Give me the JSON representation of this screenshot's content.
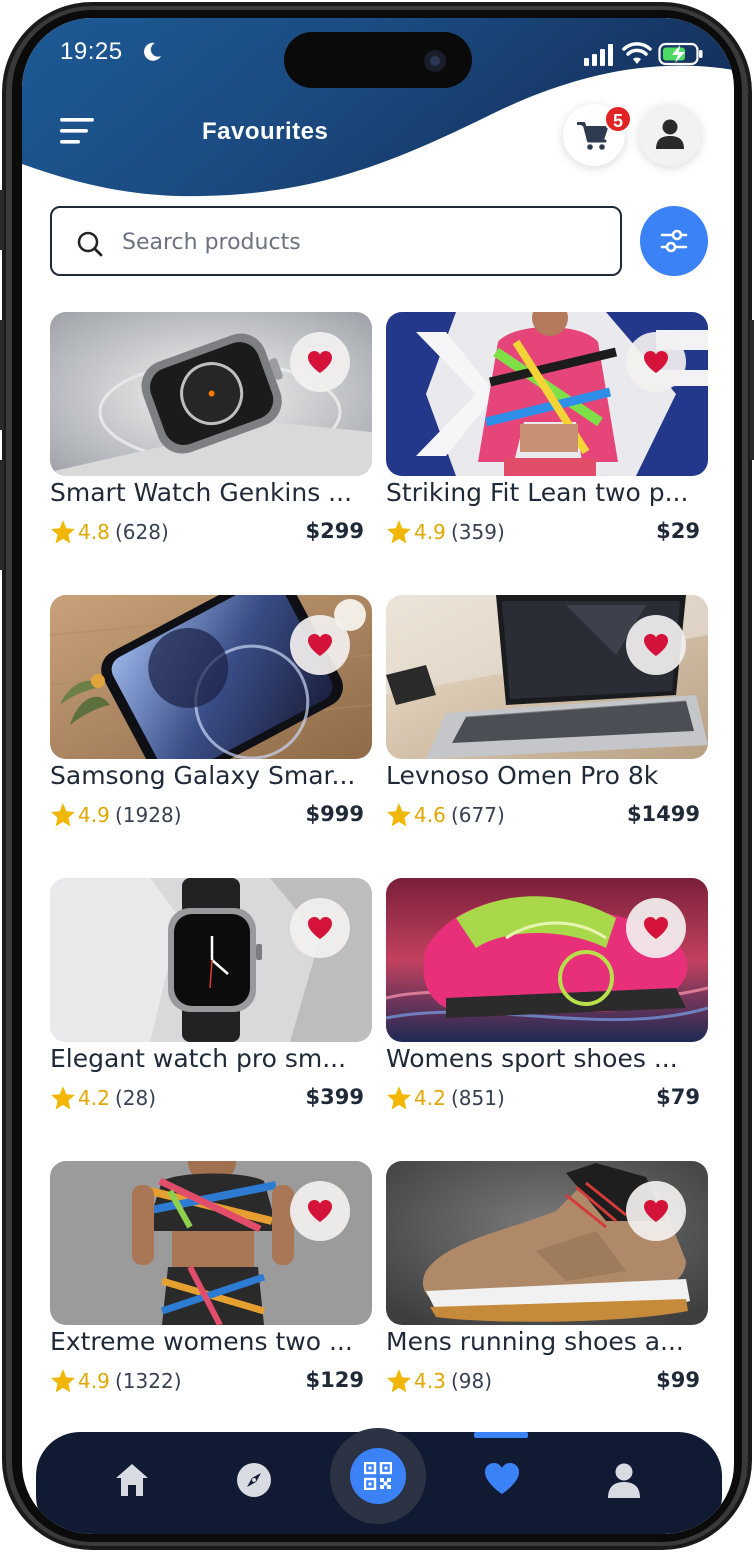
{
  "status": {
    "time": "19:25"
  },
  "header": {
    "title": "Favourites",
    "cart_badge": "5"
  },
  "search": {
    "placeholder": "Search products",
    "value": ""
  },
  "products": [
    {
      "name": "Smart Watch Genkins ...",
      "rating": "4.8",
      "count": "(628)",
      "price": "$299",
      "image": "smartwatch-silver"
    },
    {
      "name": "Striking Fit Lean two p...",
      "rating": "4.9",
      "count": "(359)",
      "price": "$29",
      "image": "sportswear-top"
    },
    {
      "name": "Samsong Galaxy Smar...",
      "rating": "4.9",
      "count": "(1928)",
      "price": "$999",
      "image": "smartphone"
    },
    {
      "name": "Levnoso Omen Pro 8k",
      "rating": "4.6",
      "count": "(677)",
      "price": "$1499",
      "image": "laptop"
    },
    {
      "name": "Elegant watch pro sm...",
      "rating": "4.2",
      "count": "(28)",
      "price": "$399",
      "image": "smartwatch-black"
    },
    {
      "name": "Womens sport shoes ...",
      "rating": "4.2",
      "count": "(851)",
      "price": "$79",
      "image": "pink-sneaker"
    },
    {
      "name": "Extreme womens two ...",
      "rating": "4.9",
      "count": "(1322)",
      "price": "$129",
      "image": "sportswear-set"
    },
    {
      "name": "Mens running shoes a...",
      "rating": "4.3",
      "count": "(98)",
      "price": "$99",
      "image": "brown-sneaker"
    }
  ],
  "nav": {
    "items": [
      {
        "icon": "home-icon"
      },
      {
        "icon": "compass-icon"
      },
      {
        "icon": "qr-code-icon"
      },
      {
        "icon": "heart-icon",
        "active": true
      },
      {
        "icon": "user-icon"
      }
    ]
  },
  "colors": {
    "accent": "#3b82f6",
    "header": "#1b4e86",
    "nav": "#101a33",
    "star": "#f2b705",
    "heart": "#e11d48",
    "badge": "#e02424"
  }
}
